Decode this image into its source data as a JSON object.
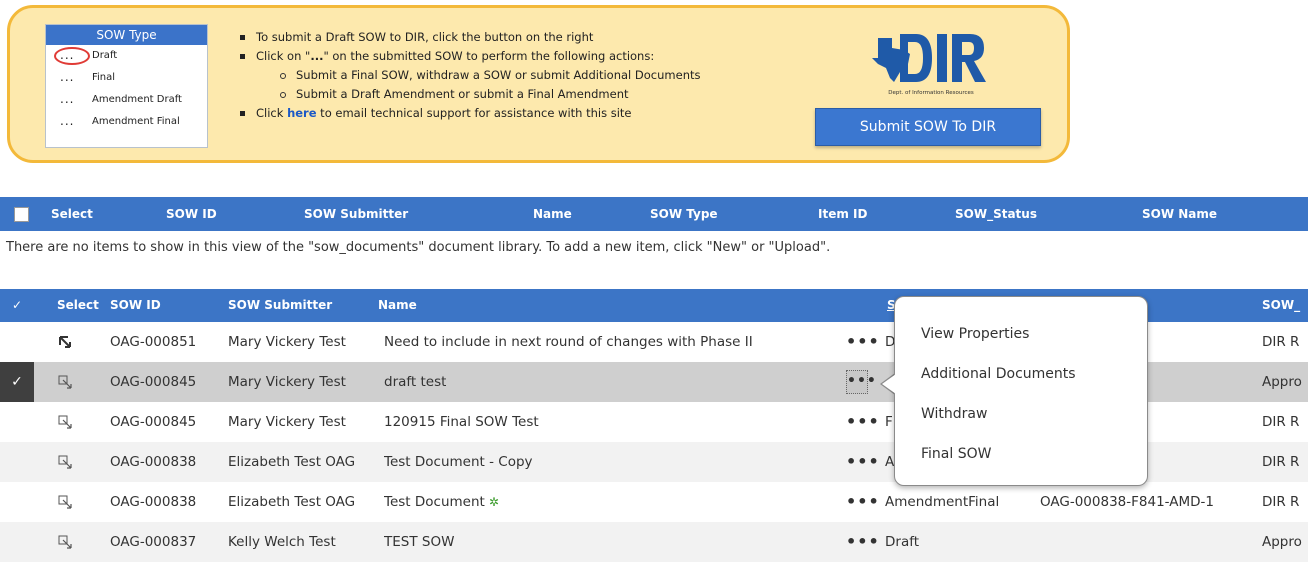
{
  "legend": {
    "title": "SOW Type",
    "items": [
      {
        "dots": "...",
        "label": "Draft",
        "circled": true
      },
      {
        "dots": "...",
        "label": "Final"
      },
      {
        "dots": "...",
        "label": "Amendment Draft"
      },
      {
        "dots": "...",
        "label": "Amendment Final"
      }
    ]
  },
  "instructions": {
    "line1": "To submit a Draft SOW to DIR, click the button on the right",
    "line2_pre": "Click on \"",
    "line2_dots": "...",
    "line2_post": "\" on the submitted SOW to perform the following actions:",
    "sub1": "Submit a Final SOW, withdraw a SOW or submit Additional Documents",
    "sub2": "Submit a Draft Amendment or submit a Final Amendment",
    "line3_pre": "Click ",
    "line3_link": "here",
    "line3_post": " to email technical support for assistance with this site"
  },
  "logo": {
    "text": "DIR",
    "caption": "Dept. of Information Resources",
    "brand_color": "#1f5aa8"
  },
  "submit_button": "Submit SOW To DIR",
  "empty_list": {
    "headers": [
      "Select",
      "SOW ID",
      "SOW Submitter",
      "Name",
      "SOW Type",
      "Item ID",
      "SOW_Status",
      "SOW Name"
    ],
    "message": "There are no items to show in this view of the \"sow_documents\" document library. To add a new item, click \"New\" or \"Upload\"."
  },
  "list": {
    "headers": {
      "check": "✓",
      "select": "Select",
      "sow_id": "SOW ID",
      "submitter": "SOW Submitter",
      "name": "Name",
      "type": "S",
      "status": "SOW_"
    },
    "rows": [
      {
        "id": "OAG-000851",
        "submitter": "Mary Vickery Test",
        "name": "Need to include in next round of changes with Phase II",
        "type": "D",
        "item": "",
        "status": "DIR R"
      },
      {
        "id": "OAG-000845",
        "submitter": "Mary Vickery Test",
        "name": "draft test",
        "type": "",
        "item": "",
        "status": "Appro",
        "selected": true
      },
      {
        "id": "OAG-000845",
        "submitter": "Mary Vickery Test",
        "name": "120915 Final SOW Test",
        "type": "F",
        "item": "",
        "status": "DIR R"
      },
      {
        "id": "OAG-000838",
        "submitter": "Elizabeth Test OAG",
        "name": "Test Document - Copy",
        "type": "A",
        "item": "",
        "status": "DIR R"
      },
      {
        "id": "OAG-000838",
        "submitter": "Elizabeth Test OAG",
        "name": "Test Document",
        "new": "✲",
        "type": "AmendmentFinal",
        "item": "OAG-000838-F841-AMD-1",
        "status": "DIR R"
      },
      {
        "id": "OAG-000837",
        "submitter": "Kelly Welch Test",
        "name": "TEST SOW",
        "type": "Draft",
        "item": "",
        "status": "Appro"
      }
    ]
  },
  "context_menu": {
    "items": [
      "View Properties",
      "Additional Documents",
      "Withdraw",
      "Final SOW"
    ]
  }
}
